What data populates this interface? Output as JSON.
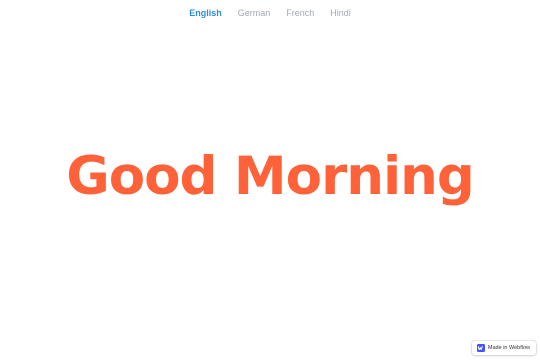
{
  "nav": {
    "tabs": [
      {
        "label": "English",
        "active": true
      },
      {
        "label": "German",
        "active": false
      },
      {
        "label": "French",
        "active": false
      },
      {
        "label": "Hindi",
        "active": false
      }
    ]
  },
  "main": {
    "greeting": "Good Morning"
  },
  "badge": {
    "label": "Made in Webflow",
    "icon": "webflow-logo-icon"
  },
  "colors": {
    "accent": "#ff6239",
    "active_tab": "#2f8ddb",
    "inactive_tab": "#a3a9b3",
    "badge_logo": "#4353ff"
  }
}
